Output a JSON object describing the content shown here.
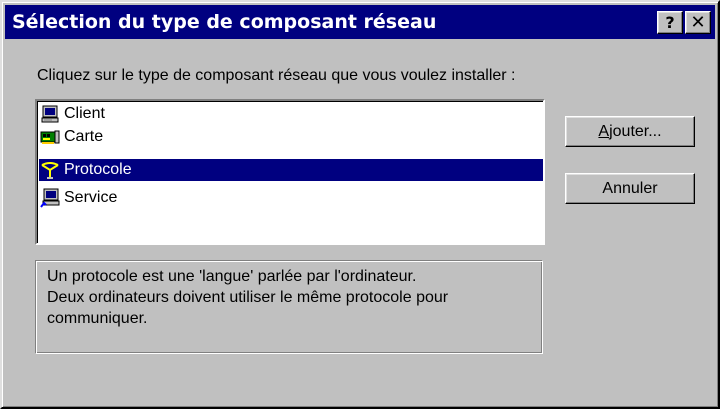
{
  "window": {
    "title": "Sélection du type de composant réseau",
    "help_label": "?",
    "close_label": "✕"
  },
  "dialog": {
    "instruction": "Cliquez sur le type de composant réseau que vous voulez installer :",
    "items": [
      {
        "label": "Client",
        "icon": "client-computer-icon",
        "selected": false
      },
      {
        "label": "Carte",
        "icon": "network-card-icon",
        "selected": false
      },
      {
        "label": "Protocole",
        "icon": "protocol-icon",
        "selected": true
      },
      {
        "label": "Service",
        "icon": "service-icon",
        "selected": false
      }
    ],
    "buttons": {
      "add_hotkey": "A",
      "add_rest": "jouter...",
      "cancel_label": "Annuler"
    },
    "description": {
      "line1": "Un protocole est une 'langue' parlée par l'ordinateur.",
      "line2": "Deux ordinateurs doivent utiliser le même protocole pour",
      "line3": "communiquer."
    }
  },
  "colors": {
    "title_bar": "#000080",
    "selection": "#000080",
    "face": "#c0c0c0"
  }
}
